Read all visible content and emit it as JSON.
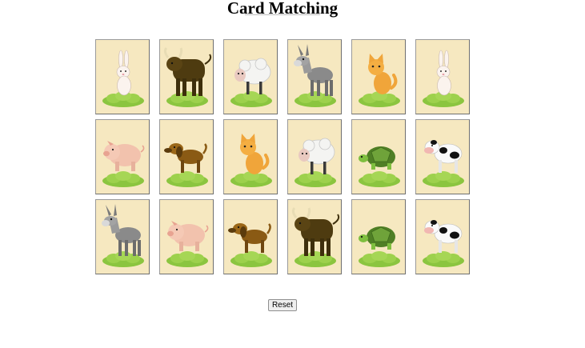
{
  "title": "Card Matching",
  "reset_label": "Reset",
  "colors": {
    "card_face": "#f6e8c0",
    "card_border": "#9a9a9a",
    "grass": "#8bc53f"
  },
  "board": {
    "rows": 3,
    "columns": 6,
    "cards": [
      [
        "rabbit",
        "bull",
        "sheep",
        "donkey",
        "cat",
        "rabbit"
      ],
      [
        "pig",
        "dog",
        "cat",
        "sheep",
        "turtle",
        "cow"
      ],
      [
        "donkey",
        "pig",
        "dog",
        "bull",
        "turtle",
        "cow"
      ]
    ]
  }
}
